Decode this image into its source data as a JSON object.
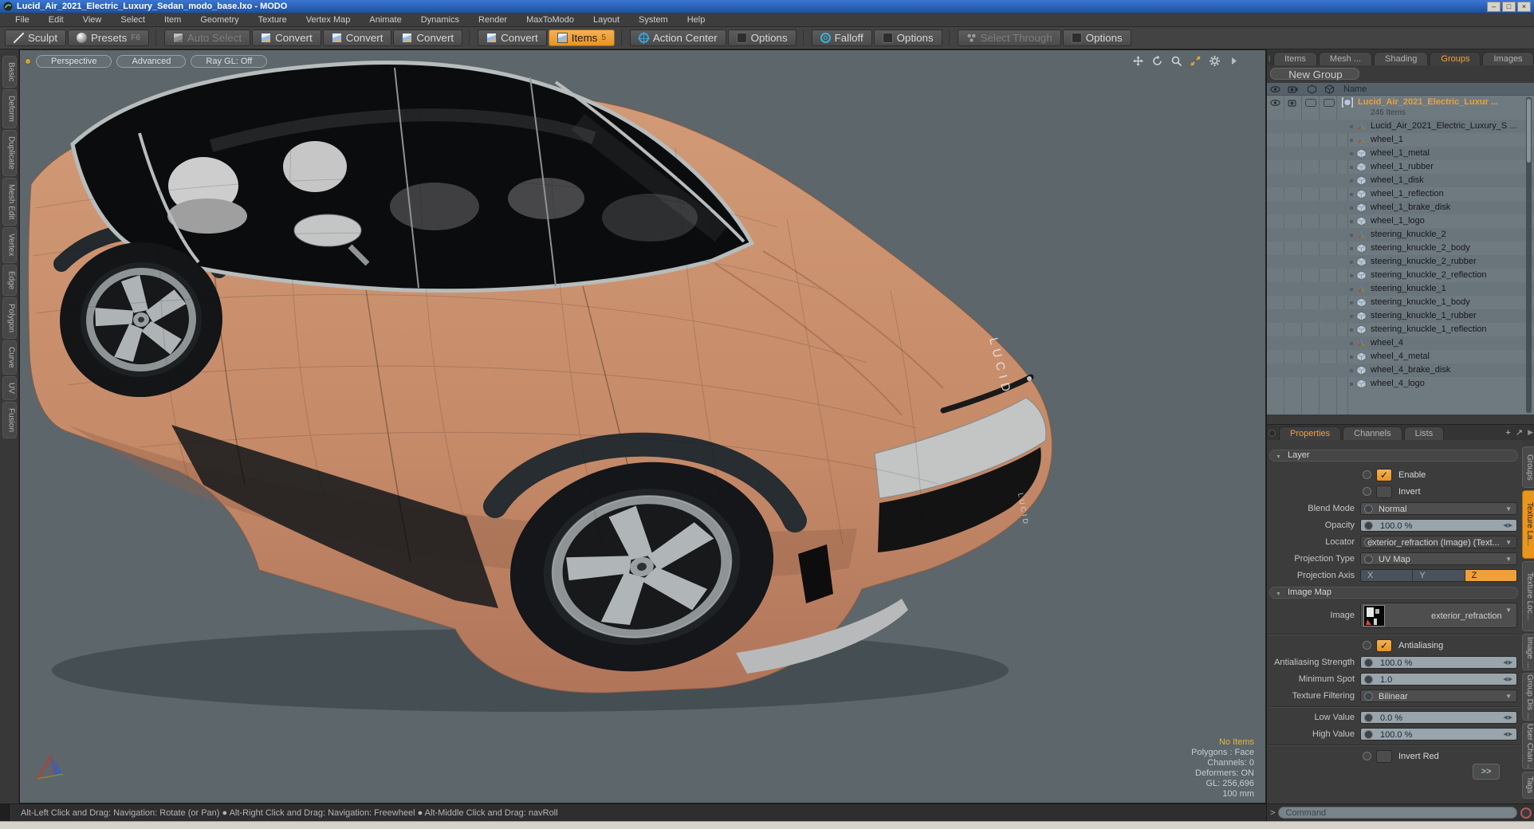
{
  "window": {
    "title": "Lucid_Air_2021_Electric_Luxury_Sedan_modo_base.lxo - MODO",
    "controls": {
      "minimize": "–",
      "maximize": "□",
      "close": "×"
    }
  },
  "menu": {
    "items": [
      "File",
      "Edit",
      "View",
      "Select",
      "Item",
      "Geometry",
      "Texture",
      "Vertex Map",
      "Animate",
      "Dynamics",
      "Render",
      "MaxToModo",
      "Layout",
      "System",
      "Help"
    ]
  },
  "toolbar": {
    "groups": [
      {
        "items": [
          {
            "label": "Sculpt",
            "icon": "pen",
            "state": "normal"
          },
          {
            "label": "Presets",
            "suffix": "F6",
            "icon": "sphere",
            "state": "normal"
          }
        ]
      },
      {
        "items": [
          {
            "label": "Auto Select",
            "icon": "cube-gray",
            "state": "disabled"
          },
          {
            "label": "Convert",
            "icon": "cube-blue",
            "state": "normal"
          },
          {
            "label": "Convert",
            "icon": "cube-blue",
            "state": "normal"
          },
          {
            "label": "Convert",
            "icon": "cube-blue",
            "state": "normal"
          }
        ]
      },
      {
        "items": [
          {
            "label": "Convert",
            "icon": "cube-blue",
            "state": "normal"
          },
          {
            "label": "Items",
            "suffix": "5",
            "icon": "cube-blue",
            "state": "active"
          }
        ]
      },
      {
        "items": [
          {
            "label": "Action Center",
            "icon": "crosshair",
            "state": "normal"
          },
          {
            "label": "Options",
            "icon": "checkbox",
            "state": "normal"
          }
        ]
      },
      {
        "items": [
          {
            "label": "Falloff",
            "icon": "falloff",
            "state": "normal"
          },
          {
            "label": "Options",
            "icon": "checkbox",
            "state": "normal"
          }
        ]
      },
      {
        "items": [
          {
            "label": "Select Through",
            "icon": "dots",
            "state": "disabled"
          },
          {
            "label": "Options",
            "icon": "checkbox",
            "state": "normal"
          }
        ]
      }
    ]
  },
  "left_tabs": [
    "Basic",
    "Deform",
    "Duplicate",
    "Mesh Edit",
    "Vertex",
    "Edge",
    "Polygon",
    "Curve",
    "UV",
    "Fusion"
  ],
  "viewport": {
    "controls": [
      "Perspective",
      "Advanced",
      "Ray GL: Off"
    ],
    "stats": {
      "highlight": "No Items",
      "rows": [
        "Polygons : Face",
        "Channels: 0",
        "Deformers: ON",
        "GL: 256,696",
        "100 mm"
      ]
    },
    "icons": [
      "pan-icon",
      "rotate-icon",
      "zoom-icon",
      "maximize-icon",
      "settings-icon",
      "expand-icon"
    ]
  },
  "right_panel": {
    "tabs": [
      {
        "label": "Items",
        "state": "normal"
      },
      {
        "label": "Mesh ...",
        "state": "normal"
      },
      {
        "label": "Shading",
        "state": "normal"
      },
      {
        "label": "Groups",
        "state": "active"
      },
      {
        "label": "Images",
        "state": "normal"
      }
    ],
    "icons": {
      "add": "+",
      "maximize": "↗",
      "more": "▶"
    },
    "new_group_label": "New Group",
    "name_column": "Name",
    "tree": [
      {
        "label": "Lucid_Air_2021_Electric_Luxur ...",
        "sub": "246 Items",
        "type": "group"
      },
      {
        "label": "Lucid_Air_2021_Electric_Luxury_S ...",
        "type": "locator"
      },
      {
        "label": "wheel_1",
        "type": "locator"
      },
      {
        "label": "wheel_1_metal",
        "type": "mesh"
      },
      {
        "label": "wheel_1_rubber",
        "type": "mesh"
      },
      {
        "label": "wheel_1_disk",
        "type": "mesh"
      },
      {
        "label": "wheel_1_reflection",
        "type": "mesh"
      },
      {
        "label": "wheel_1_brake_disk",
        "type": "mesh"
      },
      {
        "label": "wheel_1_logo",
        "type": "mesh"
      },
      {
        "label": "steering_knuckle_2",
        "type": "locator"
      },
      {
        "label": "steering_knuckle_2_body",
        "type": "mesh"
      },
      {
        "label": "steering_knuckle_2_rubber",
        "type": "mesh"
      },
      {
        "label": "steering_knuckle_2_reflection",
        "type": "mesh"
      },
      {
        "label": "steering_knuckle_1",
        "type": "locator"
      },
      {
        "label": "steering_knuckle_1_body",
        "type": "mesh"
      },
      {
        "label": "steering_knuckle_1_rubber",
        "type": "mesh"
      },
      {
        "label": "steering_knuckle_1_reflection",
        "type": "mesh"
      },
      {
        "label": "wheel_4",
        "type": "locator"
      },
      {
        "label": "wheel_4_metal",
        "type": "mesh"
      },
      {
        "label": "wheel_4_brake_disk",
        "type": "mesh"
      },
      {
        "label": "wheel_4_logo",
        "type": "mesh"
      }
    ]
  },
  "properties": {
    "tabs": [
      {
        "label": "Properties",
        "state": "active"
      },
      {
        "label": "Channels",
        "state": "normal"
      },
      {
        "label": "Lists",
        "state": "normal"
      }
    ],
    "sections": {
      "layer": "Layer",
      "image_map": "Image Map"
    },
    "check_glyph": "✓",
    "drop_arrow": "▼",
    "stepper": "◀▶",
    "fields": {
      "enable": "Enable",
      "invert": "Invert",
      "blend_mode_label": "Blend Mode",
      "blend_mode_value": "Normal",
      "opacity_label": "Opacity",
      "opacity_value": "100.0 %",
      "locator_label": "Locator",
      "locator_value": "exterior_refraction (Image) (Text...",
      "projection_type_label": "Projection Type",
      "projection_type_value": "UV Map",
      "projection_axis_label": "Projection Axis",
      "axis_x": "X",
      "axis_y": "Y",
      "axis_z": "Z",
      "image_label": "Image",
      "image_value": "exterior_refraction",
      "antialiasing": "Antialiasing",
      "aa_strength_label": "Antialiasing Strength",
      "aa_strength_value": "100.0 %",
      "min_spot_label": "Minimum Spot",
      "min_spot_value": "1.0",
      "tex_filter_label": "Texture Filtering",
      "tex_filter_value": "Bilinear",
      "low_label": "Low Value",
      "low_value": "0.0 %",
      "high_label": "High Value",
      "high_value": "100.0 %",
      "invert_red": "Invert Red",
      "more_button": ">>"
    },
    "side_tabs": [
      {
        "label": "Groups",
        "state": "normal"
      },
      {
        "label": "Texture La...",
        "state": "active"
      },
      {
        "label": "Texture Loc...",
        "state": "normal"
      },
      {
        "label": "Image ...",
        "state": "normal"
      },
      {
        "label": "Group Dis ...",
        "state": "normal"
      },
      {
        "label": "User Chan ...",
        "state": "normal"
      },
      {
        "label": "Tags",
        "state": "normal"
      }
    ]
  },
  "command": {
    "prompt": ">",
    "placeholder": "Command"
  },
  "status_bar": {
    "text": "Alt-Left Click and Drag: Navigation: Rotate (or Pan)  ●  Alt-Right Click and Drag: Navigation: Freewheel  ●  Alt-Middle Click and Drag: navRoll"
  },
  "colors": {
    "accent_orange": "#f0a03c",
    "titlebar_blue": "#2a63c4",
    "viewport_bg": "#5c666b",
    "car_body": "#c58a68",
    "highlight_text": "#e8b53c"
  }
}
